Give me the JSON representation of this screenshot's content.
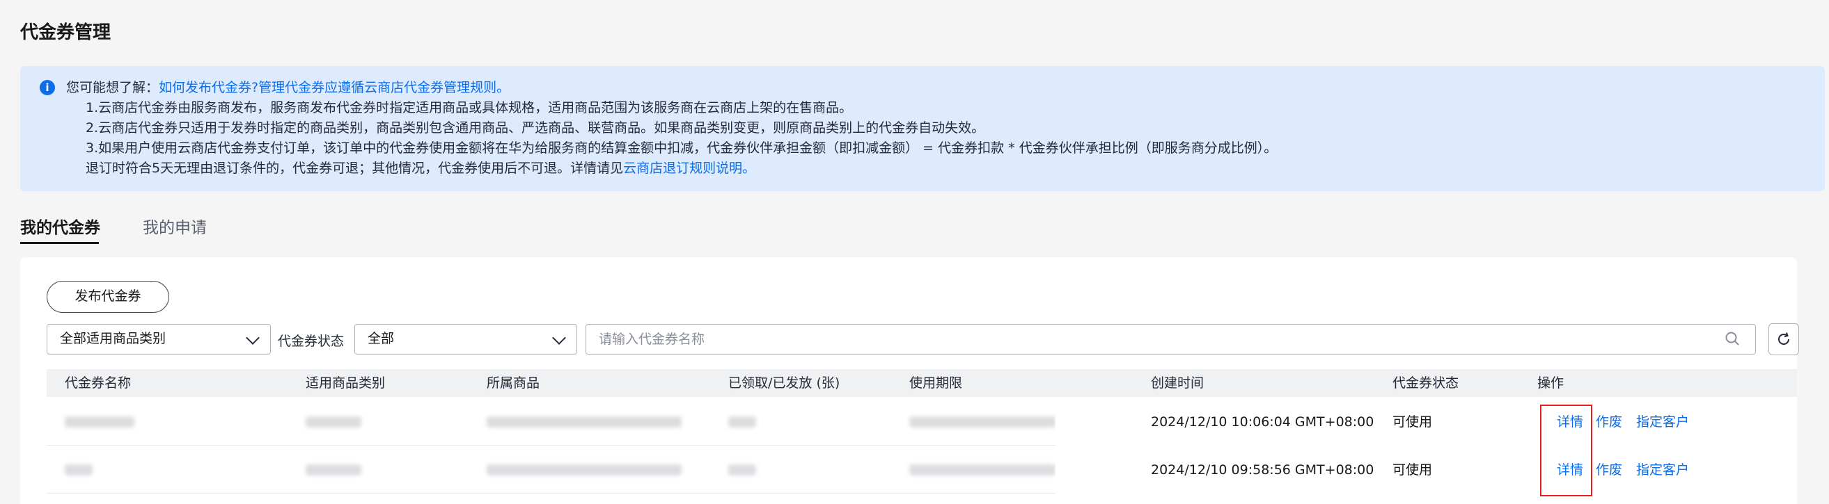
{
  "page": {
    "title": "代金券管理"
  },
  "notice": {
    "prefix": "您可能想了解：",
    "links": [
      "如何发布代金券?",
      "管理代金券应遵循云商店代金券管理规则。"
    ],
    "lines": [
      "1.云商店代金券由服务商发布，服务商发布代金券时指定适用商品或具体规格，适用商品范围为该服务商在云商店上架的在售商品。",
      "2.云商店代金券只适用于发券时指定的商品类别，商品类别包含通用商品、严选商品、联营商品。如果商品类别变更，则原商品类别上的代金券自动失效。",
      "3.如果用户使用云商店代金券支付订单，该订单中的代金券使用金额将在华为给服务商的结算金额中扣减，代金券伙伴承担金额（即扣减金额） = 代金券扣款 * 代金券伙伴承担比例（即服务商分成比例）。",
      "退订时符合5天无理由退订条件的，代金券可退；其他情况，代金券使用后不可退。详情请见"
    ],
    "last_link": "云商店退订规则说明",
    "last_suffix": "。",
    "colors": {
      "background": "#deebff",
      "link": "#0b6de8",
      "icon": "#0b6de8"
    },
    "icon": "info-icon"
  },
  "tabs": [
    {
      "label": "我的代金券",
      "active": true
    },
    {
      "label": "我的申请",
      "active": false
    }
  ],
  "toolbar": {
    "publish_label": "发布代金券",
    "category_select": "全部适用商品类别",
    "status_label": "代金券状态",
    "status_select": "全部",
    "search_placeholder": "请输入代金券名称"
  },
  "table": {
    "columns": [
      "代金券名称",
      "适用商品类别",
      "所属商品",
      "已领取/已发放 (张)",
      "使用期限",
      "创建时间",
      "代金券状态",
      "操作"
    ],
    "rows": [
      {
        "created": "2024/12/10 10:06:04 GMT+08:00",
        "status": "可使用",
        "actions": [
          "详情",
          "作废",
          "指定客户"
        ]
      },
      {
        "created": "2024/12/10 09:58:56 GMT+08:00",
        "status": "可使用",
        "actions": [
          "详情",
          "作废",
          "指定客户"
        ]
      }
    ]
  },
  "accent_color": "#0b6de8",
  "highlight_color": "#e81e1e"
}
